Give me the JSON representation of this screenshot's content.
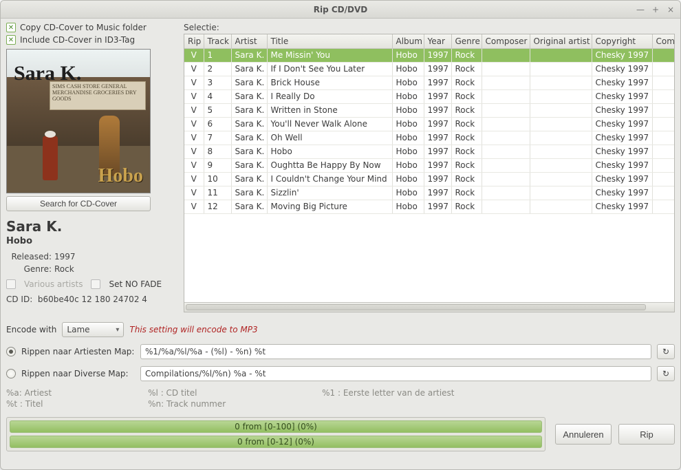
{
  "window": {
    "title": "Rip CD/DVD"
  },
  "left": {
    "copy_cover_label": "Copy CD-Cover to Music folder",
    "include_cover_label": "Include CD-Cover in ID3-Tag",
    "cover_sign_text": "SIMS CASH STORE\nGENERAL MERCHANDISE\nGROCERIES   DRY GOODS",
    "cover_artist": "Sara K.",
    "cover_album": "Hobo",
    "search_cover_button": "Search for CD-Cover",
    "artist": "Sara K.",
    "album": "Hobo",
    "released_label": "Released:",
    "released_value": "1997",
    "genre_label": "Genre:",
    "genre_value": "Rock",
    "various_artists_label": "Various artists",
    "set_no_fade_label": "Set NO FADE",
    "cdid_label": "CD ID:",
    "cdid_value": "b60be40c 12 180 24702 4"
  },
  "table": {
    "section_label": "Selectie:",
    "headers": [
      "Rip",
      "Track",
      "Artist",
      "Title",
      "Album",
      "Year",
      "Genre",
      "Composer",
      "Original artist",
      "Copyright",
      "Comm"
    ],
    "rows": [
      {
        "rip": "V",
        "track": "1",
        "artist": "Sara K.",
        "title": "Me Missin' You",
        "album": "Hobo",
        "year": "1997",
        "genre": "Rock",
        "composer": "",
        "orig": "",
        "copyright": "Chesky 1997",
        "comm": "",
        "selected": true
      },
      {
        "rip": "V",
        "track": "2",
        "artist": "Sara K.",
        "title": "If I Don't See You Later",
        "album": "Hobo",
        "year": "1997",
        "genre": "Rock",
        "composer": "",
        "orig": "",
        "copyright": "Chesky 1997",
        "comm": ""
      },
      {
        "rip": "V",
        "track": "3",
        "artist": "Sara K.",
        "title": "Brick House",
        "album": "Hobo",
        "year": "1997",
        "genre": "Rock",
        "composer": "",
        "orig": "",
        "copyright": "Chesky 1997",
        "comm": ""
      },
      {
        "rip": "V",
        "track": "4",
        "artist": "Sara K.",
        "title": "I Really Do",
        "album": "Hobo",
        "year": "1997",
        "genre": "Rock",
        "composer": "",
        "orig": "",
        "copyright": "Chesky 1997",
        "comm": ""
      },
      {
        "rip": "V",
        "track": "5",
        "artist": "Sara K.",
        "title": "Written in Stone",
        "album": "Hobo",
        "year": "1997",
        "genre": "Rock",
        "composer": "",
        "orig": "",
        "copyright": "Chesky 1997",
        "comm": ""
      },
      {
        "rip": "V",
        "track": "6",
        "artist": "Sara K.",
        "title": "You'll Never Walk Alone",
        "album": "Hobo",
        "year": "1997",
        "genre": "Rock",
        "composer": "",
        "orig": "",
        "copyright": "Chesky 1997",
        "comm": ""
      },
      {
        "rip": "V",
        "track": "7",
        "artist": "Sara K.",
        "title": "Oh Well",
        "album": "Hobo",
        "year": "1997",
        "genre": "Rock",
        "composer": "",
        "orig": "",
        "copyright": "Chesky 1997",
        "comm": ""
      },
      {
        "rip": "V",
        "track": "8",
        "artist": "Sara K.",
        "title": "Hobo",
        "album": "Hobo",
        "year": "1997",
        "genre": "Rock",
        "composer": "",
        "orig": "",
        "copyright": "Chesky 1997",
        "comm": ""
      },
      {
        "rip": "V",
        "track": "9",
        "artist": "Sara K.",
        "title": "Oughtta Be Happy By Now",
        "album": "Hobo",
        "year": "1997",
        "genre": "Rock",
        "composer": "",
        "orig": "",
        "copyright": "Chesky 1997",
        "comm": ""
      },
      {
        "rip": "V",
        "track": "10",
        "artist": "Sara K.",
        "title": "I Couldn't Change Your Mind",
        "album": "Hobo",
        "year": "1997",
        "genre": "Rock",
        "composer": "",
        "orig": "",
        "copyright": "Chesky 1997",
        "comm": ""
      },
      {
        "rip": "V",
        "track": "11",
        "artist": "Sara K.",
        "title": "Sizzlin'",
        "album": "Hobo",
        "year": "1997",
        "genre": "Rock",
        "composer": "",
        "orig": "",
        "copyright": "Chesky 1997",
        "comm": ""
      },
      {
        "rip": "V",
        "track": "12",
        "artist": "Sara K.",
        "title": "Moving Big Picture",
        "album": "Hobo",
        "year": "1997",
        "genre": "Rock",
        "composer": "",
        "orig": "",
        "copyright": "Chesky 1997",
        "comm": ""
      }
    ]
  },
  "encode": {
    "label": "Encode with",
    "selected": "Lame",
    "hint": "This setting will encode to MP3"
  },
  "dest": {
    "artist_map_label": "Rippen naar Artiesten Map:",
    "artist_map_value": "%1/%a/%l/%a - (%l) - %n) %t",
    "diverse_map_label": "Rippen naar Diverse Map:",
    "diverse_map_value": "Compilations/%l/%n) %a - %t"
  },
  "legend": {
    "a": "%a: Artiest",
    "t": "%t : Titel",
    "l": "%l : CD titel",
    "n": "%n: Track nummer",
    "one": "%1 : Eerste letter van de artiest"
  },
  "progress": {
    "bar1": "0 from [0-100] (0%)",
    "bar2": "0 from [0-12] (0%)"
  },
  "buttons": {
    "cancel": "Annuleren",
    "rip": "Rip"
  }
}
